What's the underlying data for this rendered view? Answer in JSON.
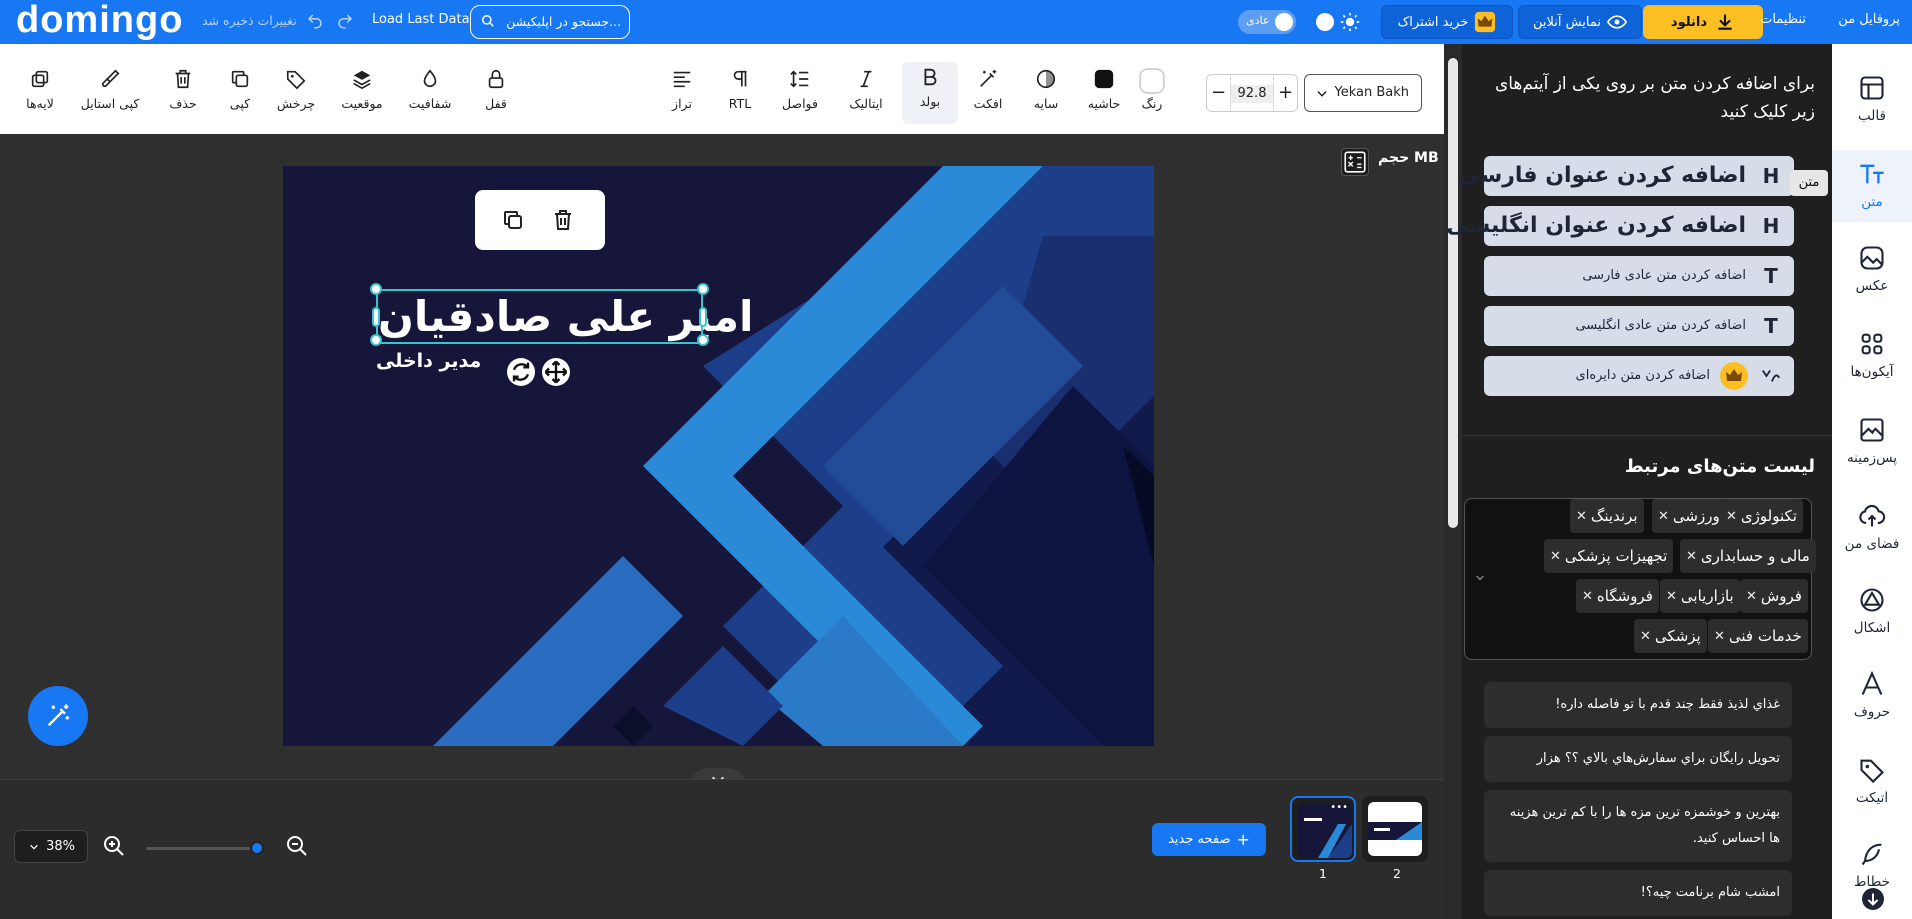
{
  "app": {
    "logo": "domingo"
  },
  "topbar": {
    "autosave": "تغییرات ذخیره شد",
    "load_last": "Load Last Data",
    "search_placeholder": "جستجو در اپلیکیشن...",
    "theme_toggle": "عادی",
    "subscribe": "خرید اشتراک",
    "preview": "نمایش آنلاین",
    "download": "دانلود",
    "settings": "تنظیمات",
    "profile": "پروفایل من"
  },
  "toolbar": {
    "font_name": "Yekan Bakh",
    "font_size": "92.8",
    "left_tools": [
      {
        "label": "لایه‌ها",
        "icon": "layers-icon"
      },
      {
        "label": "کپی استایل",
        "icon": "brush-icon"
      },
      {
        "label": "حذف",
        "icon": "trash-icon"
      },
      {
        "label": "کپی",
        "icon": "copy-icon"
      },
      {
        "label": "چرخش",
        "icon": "rotate-tag-icon"
      },
      {
        "label": "موقعیت",
        "icon": "stack-icon"
      },
      {
        "label": "شفافیت",
        "icon": "drop-icon"
      },
      {
        "label": "قفل",
        "icon": "lock-icon"
      }
    ],
    "right_tools": [
      {
        "label": "تراز",
        "icon": "align-icon"
      },
      {
        "label": "RTL",
        "icon": "pilcrow-icon"
      },
      {
        "label": "فواصل",
        "icon": "line-height-icon"
      },
      {
        "label": "ایتالیک",
        "icon": "italic-icon"
      },
      {
        "label": "بولد",
        "icon": "bold-icon"
      },
      {
        "label": "افکت",
        "icon": "magic-wand-icon"
      },
      {
        "label": "سایه",
        "icon": "shadow-icon"
      },
      {
        "label": "حاشیه",
        "icon": "border-swatch-icon"
      },
      {
        "label": "رنگ",
        "icon": "color-swatch-icon"
      }
    ]
  },
  "canvas": {
    "size_label": "حجم MB",
    "name": "امیر علی صادقیان",
    "role": "مدیر داخلی"
  },
  "bottom": {
    "zoom": "38%",
    "new_page": "صفحه جدید",
    "pages": [
      "1",
      "2"
    ]
  },
  "panel": {
    "title": "برای اضافه کردن متن بر روی یکی از آیتم‌های زیر کلیک کنید",
    "add_buttons": [
      {
        "label": "اضافه کردن عنوان فارسی",
        "icon": "H"
      },
      {
        "label": "اضافه کردن عنوان انگلیسی",
        "icon": "H"
      },
      {
        "label": "اضافه کردن متن عادی فارسی",
        "icon": "T"
      },
      {
        "label": "اضافه کردن متن عادی انگلیسی",
        "icon": "T"
      },
      {
        "label": "اضافه کردن متن دایره‌ای",
        "icon": "curve"
      }
    ],
    "list_title": "لیست متن‌های مرتبط",
    "tags": [
      "تکنولوژی",
      "ورزشی",
      "برندینگ",
      "مالی و حسابداری",
      "تجهیزات پزشکی",
      "فروش",
      "بازاریابی",
      "فروشگاه",
      "خدمات فنی",
      "پزشکی"
    ],
    "samples": [
      "غذاي لذيذ فقط چند قدم با تو فاصله داره!",
      "تحويل رايگان براي سفارش‌هاي بالاي ؟؟ هزار",
      "بهترين و خوشمزه ترين مزه ها را با كم ترين هزينه ها احساس كنيد.",
      "امشب شام برنامت چيه؟!"
    ]
  },
  "nav": {
    "tooltip": "متن",
    "items": [
      {
        "label": "قالب",
        "icon": "template-icon"
      },
      {
        "label": "متن",
        "icon": "text-icon"
      },
      {
        "label": "عکس",
        "icon": "image-icon"
      },
      {
        "label": "آیکون‌ها",
        "icon": "grid-icon"
      },
      {
        "label": "پس‌زمینه",
        "icon": "background-icon"
      },
      {
        "label": "فضای من",
        "icon": "cloud-upload-icon"
      },
      {
        "label": "اشکال",
        "icon": "shape-icon"
      },
      {
        "label": "حروف",
        "icon": "letter-icon"
      },
      {
        "label": "اتیکت",
        "icon": "tag-icon"
      },
      {
        "label": "خطاط",
        "icon": "feather-icon"
      }
    ]
  },
  "colors": {
    "brand": "#1877f2",
    "accent_yellow": "#fbbf24",
    "selection": "#37c4cf",
    "canvas_bg": "#16163a"
  }
}
